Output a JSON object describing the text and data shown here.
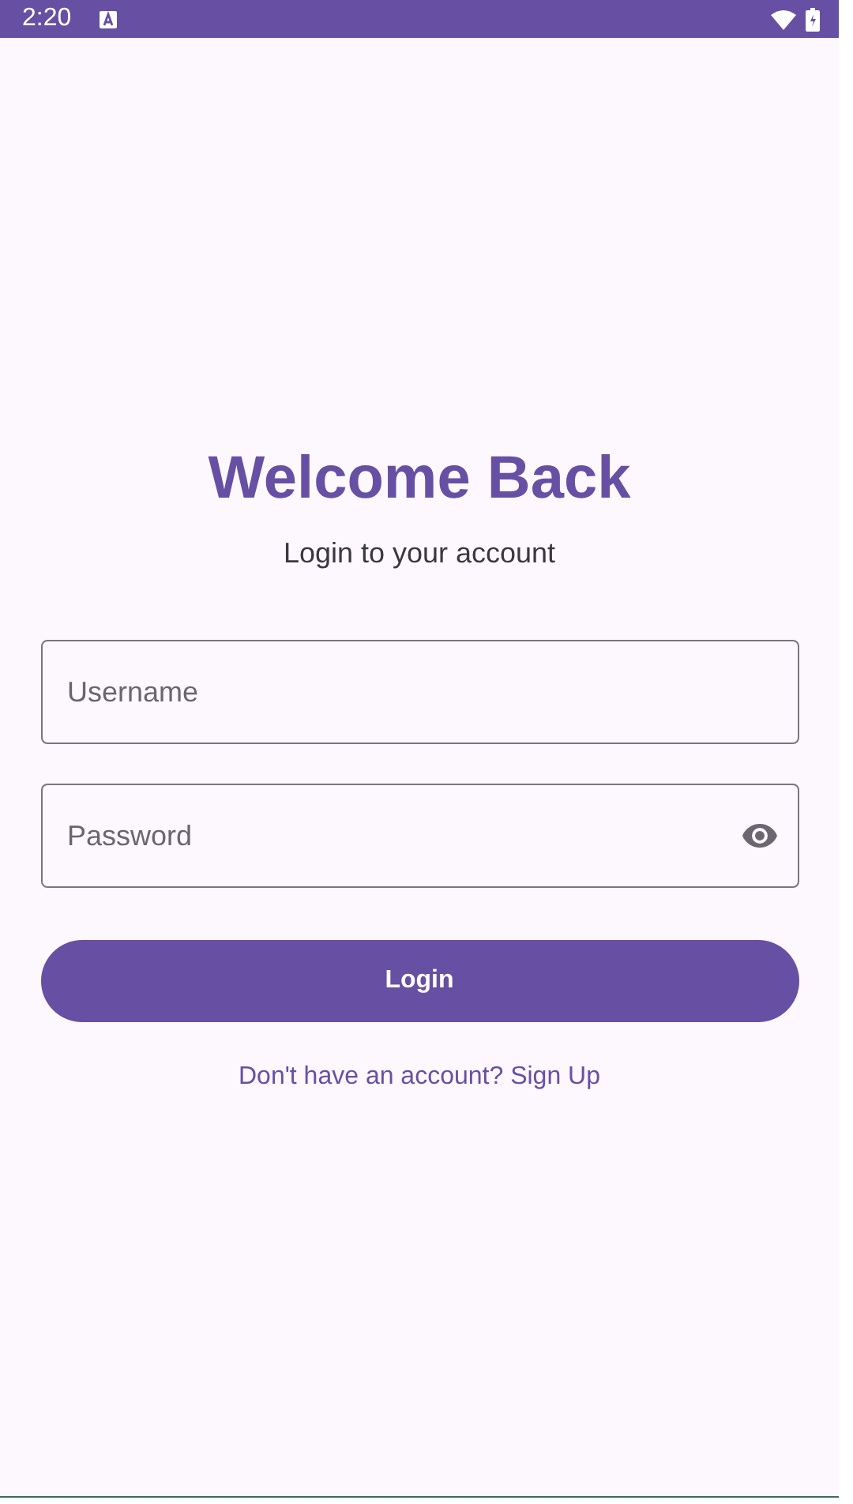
{
  "status_bar": {
    "time": "2:20"
  },
  "title": "Welcome Back",
  "subtitle": "Login to your account",
  "fields": [
    {
      "kind": "text",
      "placeholder": "Username"
    },
    {
      "kind": "password",
      "placeholder": "Password"
    }
  ],
  "login_button": "Login",
  "signup_link": "Don't have an account? Sign Up"
}
